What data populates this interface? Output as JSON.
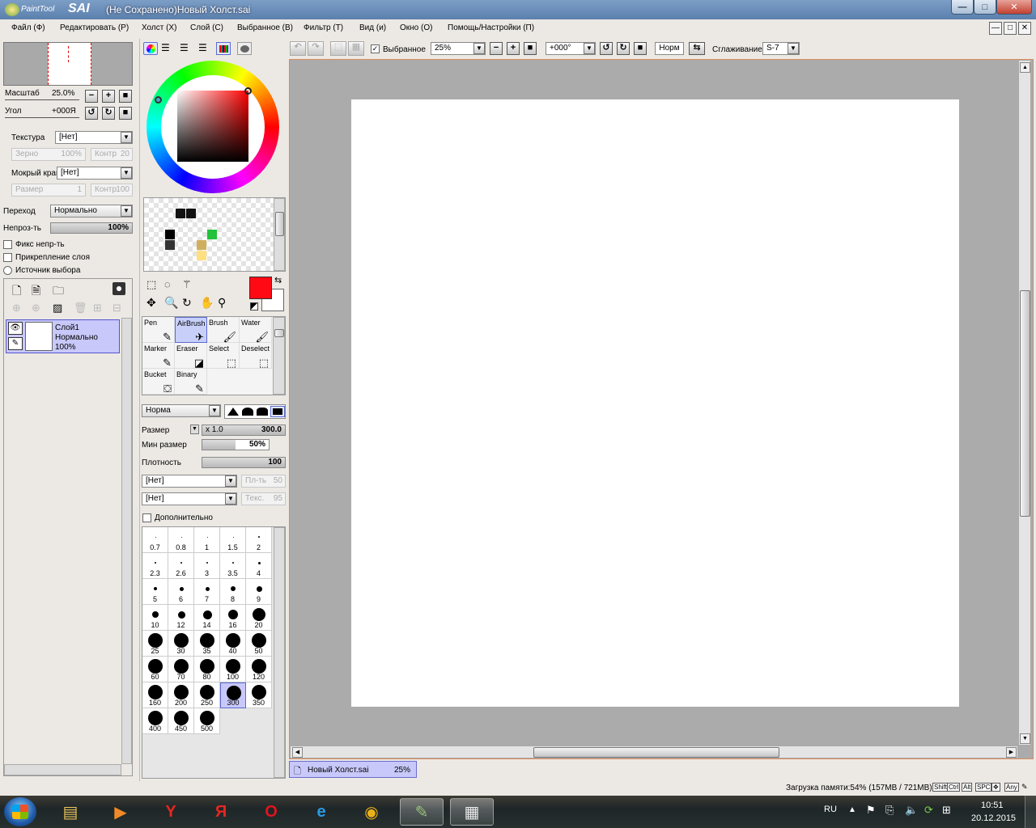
{
  "window": {
    "logo_small": "PaintTool",
    "logo_big": "SAI",
    "title": "(Не Сохранено)Новый Холст.sai",
    "min": "—",
    "max": "□",
    "close": "✕"
  },
  "menu": [
    "Файл (Ф)",
    "Редактировать (Р)",
    "Холст (Х)",
    "Слой (С)",
    "Выбранное (В)",
    "Фильтр (Т)",
    "Вид (и)",
    "Окно (О)",
    "Помощь/Настройки (П)"
  ],
  "navigator": {
    "zoom_label": "Масштаб",
    "zoom_value": "25.0%",
    "angle_label": "Угол",
    "angle_value": "+000Я"
  },
  "brush_texture": {
    "texture_label": "Текстура",
    "texture_value": "[Нет]",
    "grain_label": "Зерно",
    "grain_value": "100%",
    "contrast_label": "Контр",
    "contrast_value": "20",
    "wet_label": "Мокрый край",
    "wet_value": "[Нет]",
    "size_label": "Размер",
    "size_value": "1",
    "contrast2_label": "Контр",
    "contrast2_value": "100"
  },
  "layer_props": {
    "blend_label": "Переход",
    "blend_value": "Нормально",
    "opacity_label": "Непроз-ть",
    "opacity_value": "100%",
    "opacity_level": 1.0,
    "fix_opacity": "Фикс непр-ть",
    "clip_layer": "Прикрепление слоя",
    "selection_source": "Источник выбора"
  },
  "layers": [
    {
      "name": "Слой1",
      "mode": "Нормально",
      "opacity": "100%"
    }
  ],
  "color": {
    "primary": "#ff0a14",
    "secondary": "#ffffff",
    "swap_icon": "⇆"
  },
  "swatches": [
    {
      "col": 3,
      "row": 1,
      "color": "#111111"
    },
    {
      "col": 4,
      "row": 1,
      "color": "#111111"
    },
    {
      "col": 2,
      "row": 3,
      "color": "#000000"
    },
    {
      "col": 6,
      "row": 3,
      "color": "#22c23a"
    },
    {
      "col": 2,
      "row": 4,
      "color": "#333333"
    },
    {
      "col": 5,
      "row": 4,
      "color": "#d0b060"
    },
    {
      "col": 5,
      "row": 5,
      "color": "#ffe080"
    }
  ],
  "tools": [
    {
      "name": "Pen",
      "icon": "✎"
    },
    {
      "name": "AirBrush",
      "icon": "✈",
      "selected": true
    },
    {
      "name": "Brush",
      "icon": "🖌"
    },
    {
      "name": "Water",
      "icon": "🖌"
    },
    {
      "name": "Marker",
      "icon": "✎"
    },
    {
      "name": "Eraser",
      "icon": "◪"
    },
    {
      "name": "Select",
      "icon": "⬚"
    },
    {
      "name": "Deselect",
      "icon": "⬚"
    },
    {
      "name": "Bucket",
      "icon": "⛋"
    },
    {
      "name": "Binary",
      "icon": "✎"
    }
  ],
  "brush_settings": {
    "mode_value": "Норма",
    "size_label": "Размер",
    "size_mult": "x 1.0",
    "size_value": "300.0",
    "minsize_label": "Мин размер",
    "minsize_value": "50%",
    "minsize_level": 0.5,
    "density_label": "Плотность",
    "density_value": "100",
    "density_level": 1.0,
    "shape1": "[Нет]",
    "shape1_label": "Пл-ть",
    "shape1_val": "50",
    "shape2": "[Нет]",
    "shape2_label": "Текс.",
    "shape2_val": "95",
    "advanced": "Дополнительно"
  },
  "brush_sizes": [
    {
      "v": "0.7",
      "d": 1
    },
    {
      "v": "0.8",
      "d": 1
    },
    {
      "v": "1",
      "d": 1
    },
    {
      "v": "1.5",
      "d": 1
    },
    {
      "v": "2",
      "d": 2
    },
    {
      "v": "2.3",
      "d": 2
    },
    {
      "v": "2.6",
      "d": 2
    },
    {
      "v": "3",
      "d": 2
    },
    {
      "v": "3.5",
      "d": 2
    },
    {
      "v": "4",
      "d": 3
    },
    {
      "v": "5",
      "d": 4
    },
    {
      "v": "6",
      "d": 5
    },
    {
      "v": "7",
      "d": 5
    },
    {
      "v": "8",
      "d": 6
    },
    {
      "v": "9",
      "d": 7
    },
    {
      "v": "10",
      "d": 8
    },
    {
      "v": "12",
      "d": 9
    },
    {
      "v": "14",
      "d": 11
    },
    {
      "v": "16",
      "d": 12
    },
    {
      "v": "20",
      "d": 16
    },
    {
      "v": "25",
      "d": 18
    },
    {
      "v": "30",
      "d": 18
    },
    {
      "v": "35",
      "d": 18
    },
    {
      "v": "40",
      "d": 18
    },
    {
      "v": "50",
      "d": 18
    },
    {
      "v": "60",
      "d": 18
    },
    {
      "v": "70",
      "d": 18
    },
    {
      "v": "80",
      "d": 18
    },
    {
      "v": "100",
      "d": 18
    },
    {
      "v": "120",
      "d": 18
    },
    {
      "v": "160",
      "d": 18
    },
    {
      "v": "200",
      "d": 18
    },
    {
      "v": "250",
      "d": 18
    },
    {
      "v": "300",
      "d": 18,
      "selected": true
    },
    {
      "v": "350",
      "d": 18
    },
    {
      "v": "400",
      "d": 18
    },
    {
      "v": "450",
      "d": 18
    },
    {
      "v": "500",
      "d": 18
    }
  ],
  "toolbar": {
    "selection_label": "Выбранное",
    "zoom_value": "25%",
    "angle_value": "+000°",
    "norm_label": "Норм",
    "smooth_label": "Сглаживание",
    "smooth_value": "S-7"
  },
  "canvas_tab": {
    "name": "Новый Холст.sai",
    "zoom": "25%"
  },
  "status": {
    "memory": "Загрузка памяти:54% (157MB / 721MB)",
    "keys": [
      "Shift",
      "Ctrl",
      "Alt",
      "SPC",
      "✥",
      "Any",
      "✎"
    ]
  },
  "taskbar": {
    "lang": "RU",
    "time": "10:51",
    "date": "20.12.2015",
    "apps": [
      {
        "name": "explorer",
        "glyph": "▤",
        "color": "#e8c25a"
      },
      {
        "name": "media",
        "glyph": "▶",
        "color": "#f08a28"
      },
      {
        "name": "yandex-browser",
        "glyph": "Y",
        "color": "#e52620"
      },
      {
        "name": "yandex",
        "glyph": "Я",
        "color": "#e52620"
      },
      {
        "name": "opera",
        "glyph": "O",
        "color": "#e0141e"
      },
      {
        "name": "ie",
        "glyph": "e",
        "color": "#2a9ae4"
      },
      {
        "name": "chrome",
        "glyph": "◉",
        "color": "#e9b21a"
      },
      {
        "name": "paint-tool-sai",
        "glyph": "✎",
        "color": "#9ac27a",
        "active": true
      },
      {
        "name": "sai-document",
        "glyph": "▦",
        "color": "#e8e8e8",
        "active": true
      }
    ]
  }
}
